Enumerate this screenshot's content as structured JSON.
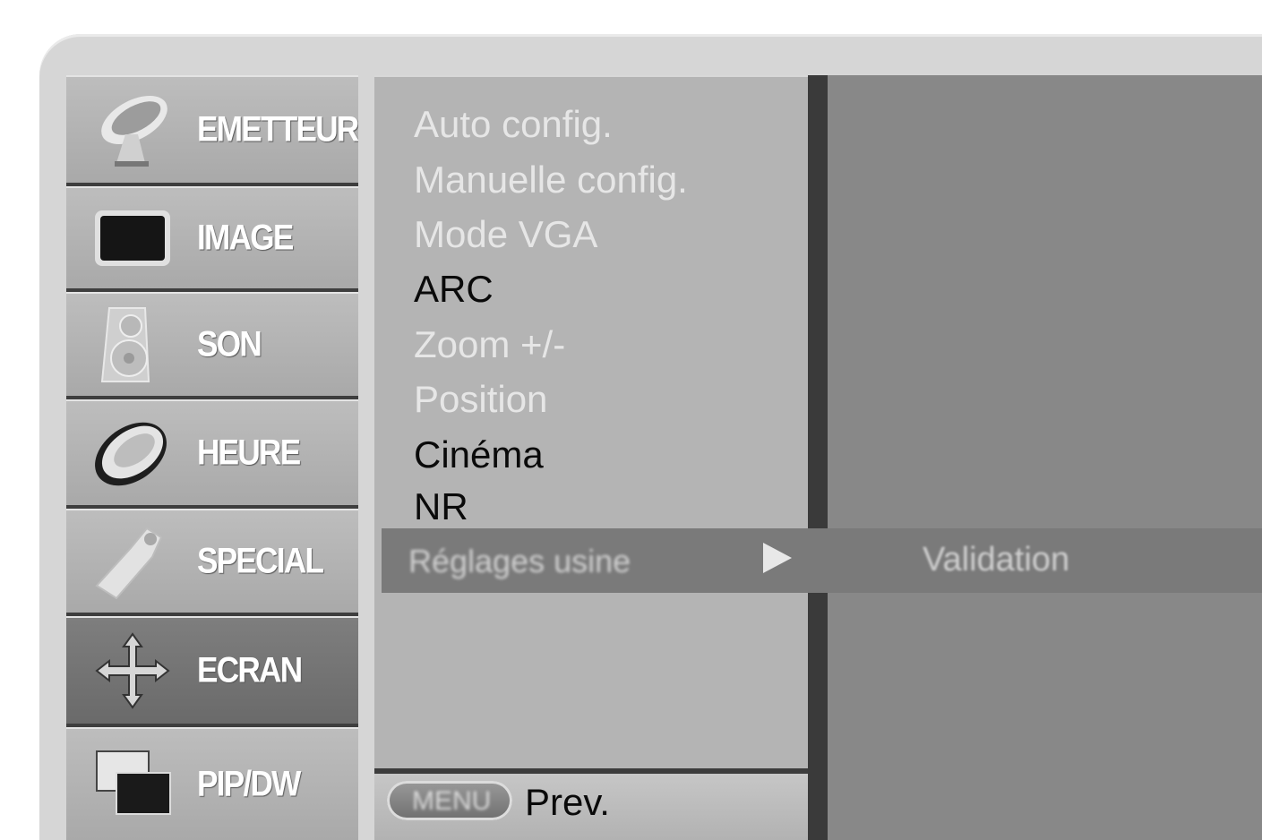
{
  "categories": [
    {
      "label": "EMETTEUR",
      "icon": "satellite-dish-icon",
      "selected": false
    },
    {
      "label": "IMAGE",
      "icon": "picture-screen-icon",
      "selected": false
    },
    {
      "label": "SON",
      "icon": "speaker-icon",
      "selected": false
    },
    {
      "label": "HEURE",
      "icon": "clock-icon",
      "selected": false
    },
    {
      "label": "SPECIAL",
      "icon": "tag-icon",
      "selected": false
    },
    {
      "label": "ECRAN",
      "icon": "move-arrows-icon",
      "selected": true
    },
    {
      "label": "PIP/DW",
      "icon": "pip-windows-icon",
      "selected": false
    }
  ],
  "menu": {
    "items": [
      {
        "label": "Auto config.",
        "enabled": false
      },
      {
        "label": "Manuelle config.",
        "enabled": false
      },
      {
        "label": "Mode VGA",
        "enabled": false
      },
      {
        "label": "ARC",
        "enabled": true
      },
      {
        "label": "Zoom +/-",
        "enabled": false
      },
      {
        "label": "Position",
        "enabled": false
      },
      {
        "label": "Cinéma",
        "enabled": true
      },
      {
        "label": "NR",
        "enabled": true
      }
    ],
    "highlighted": {
      "label": "Réglages usine",
      "submenu_value": "Validation"
    }
  },
  "footer": {
    "menu_key": "MENU",
    "prev_label": "Prev."
  },
  "colors": {
    "panel": "#b4b4b4",
    "highlight": "#7a7a7a",
    "right_panel": "#888888",
    "enabled_text": "#0a0a0a",
    "disabled_text": "#e6e6e6"
  }
}
